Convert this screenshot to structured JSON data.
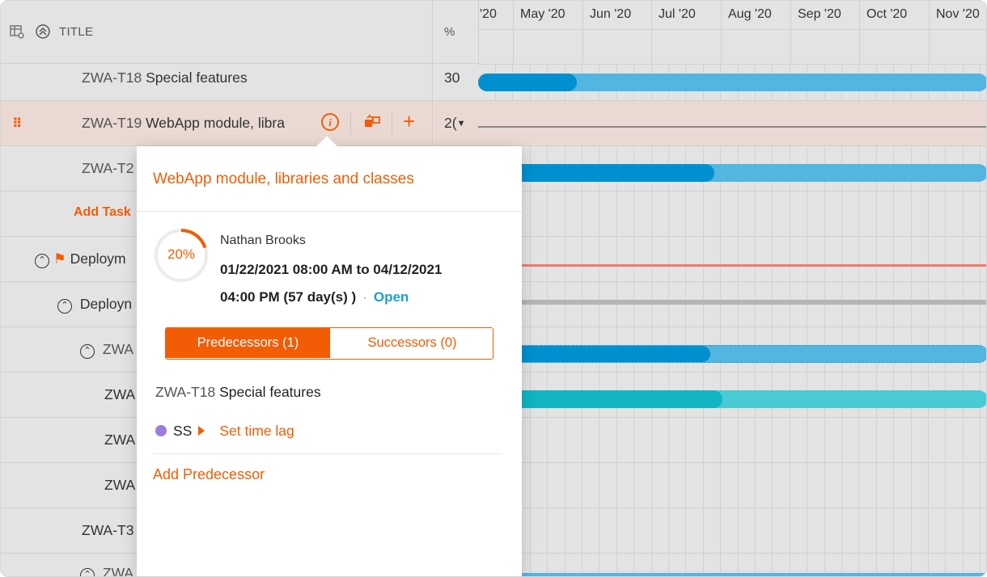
{
  "header": {
    "title_label": "TITLE",
    "percent_label": "%",
    "icons": [
      "grid-settings-icon",
      "collapse-all-icon"
    ]
  },
  "rows": [
    {
      "id": "ZWA-T18",
      "title": "Special features",
      "percent": "30"
    },
    {
      "id": "ZWA-T19",
      "title": "WebApp module, libra",
      "percent": "2("
    },
    {
      "id": "ZWA-T2",
      "title": "",
      "percent": ""
    },
    {
      "add_task": "Add Task"
    },
    {
      "title": "Deploym"
    },
    {
      "title": "Deployn"
    },
    {
      "title": "ZWA"
    },
    {
      "title": "ZWA"
    },
    {
      "title": "ZWA"
    },
    {
      "title": "ZWA"
    },
    {
      "title": "ZWA-T3"
    },
    {
      "title": "ZWA"
    }
  ],
  "timeline": {
    "months": [
      "'20",
      "May '20",
      "Jun '20",
      "Jul '20",
      "Aug '20",
      "Sep '20",
      "Oct '20",
      "Nov '20"
    ]
  },
  "popover": {
    "title": "WebApp module, libraries and classes",
    "progress_label": "20%",
    "progress_value": 0.2,
    "assignee": "Nathan Brooks",
    "dates_line1": "01/22/2021 08:00 AM to 04/12/2021",
    "dates_line2": "04:00 PM (57 day(s) )",
    "separator": "·",
    "status": "Open",
    "tabs": {
      "predecessors": "Predecessors (1)",
      "successors": "Successors (0)"
    },
    "predecessor": {
      "id": "ZWA-T18",
      "title": "Special features",
      "type": "SS",
      "set_lag": "Set time lag"
    },
    "add_predecessor": "Add Predecessor"
  },
  "colors": {
    "accent": "#f25c05",
    "bar_dark": "#0090d0",
    "bar_light": "#52b6e0",
    "teal_dark": "#11b5c3",
    "teal_light": "#48cbd4",
    "status_blue": "#1a9fd6",
    "relation_purple": "#9b7ce0"
  }
}
